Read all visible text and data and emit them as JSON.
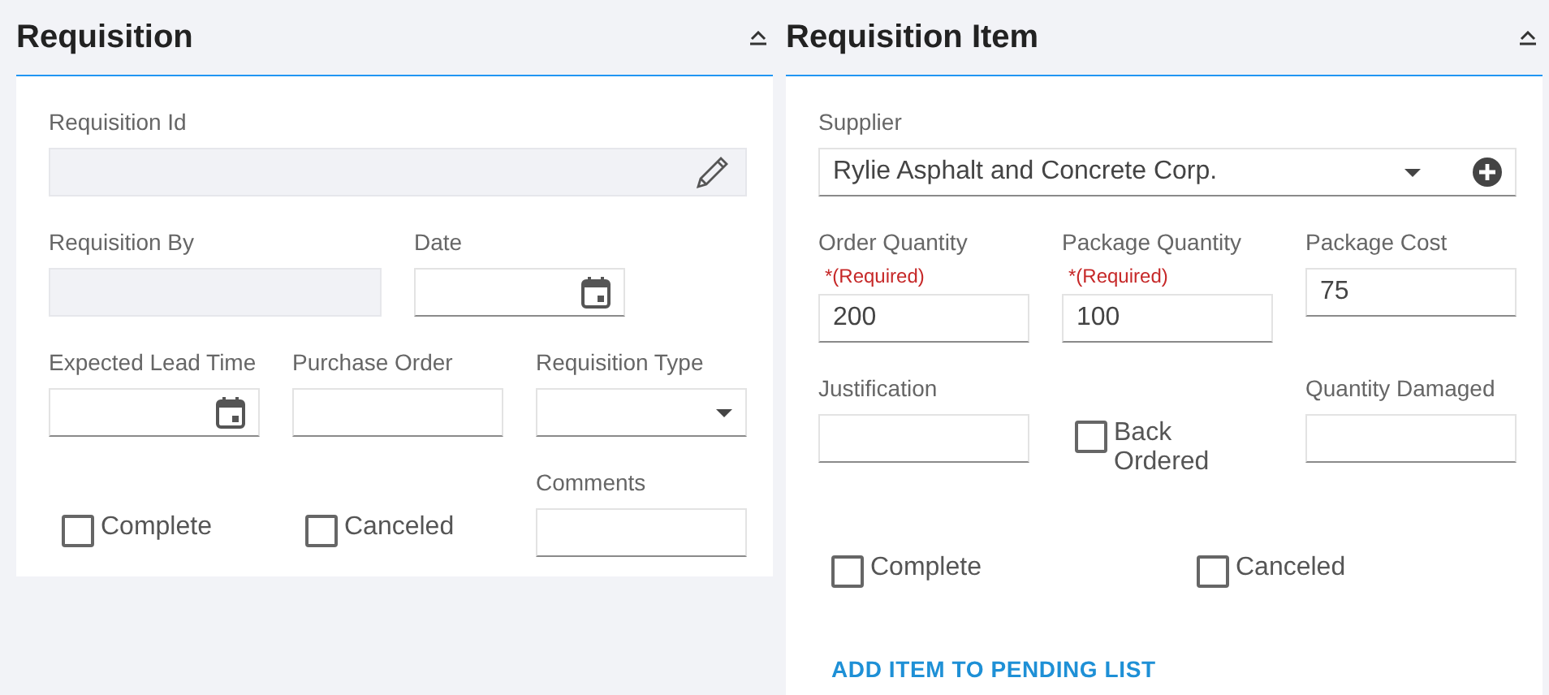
{
  "panels": [
    {
      "title": "Requisition",
      "rows": [
        [
          {
            "kind": "edit",
            "label": "Requisition Id",
            "disabled": true
          }
        ],
        [
          {
            "kind": "text",
            "label": "Requisition By",
            "disabled": true
          },
          {
            "kind": "date",
            "label": "Date"
          }
        ],
        [
          {
            "kind": "date",
            "label": "Expected Lead Time"
          },
          {
            "kind": "text",
            "label": "Purchase Order"
          },
          {
            "kind": "select",
            "label": "Requisition Type"
          }
        ],
        [
          {
            "kind": "checkbox",
            "label": "Complete",
            "checked": false
          },
          {
            "kind": "checkbox",
            "label": "Canceled",
            "checked": false
          },
          {
            "kind": "text",
            "label": "Comments"
          }
        ]
      ]
    },
    {
      "title": "Requisition Item",
      "rows": [
        [
          {
            "kind": "lookup",
            "label": "Supplier",
            "value": "Rylie Asphalt and Concrete Corp."
          }
        ],
        [
          {
            "kind": "text",
            "label": "Order Quantity",
            "required_note": "*(Required)",
            "value": "200"
          },
          {
            "kind": "text",
            "label": "Package Quantity",
            "required_note": "*(Required)",
            "value": "100"
          },
          {
            "kind": "text",
            "label": "Package Cost",
            "value": "75"
          }
        ],
        [
          {
            "kind": "text",
            "label": "Justification"
          },
          {
            "kind": "checkbox",
            "label": "Back Ordered",
            "checked": false
          },
          {
            "kind": "text",
            "label": "Quantity Damaged"
          }
        ],
        [
          {
            "kind": "checkbox",
            "label": "Complete",
            "checked": false
          },
          {
            "kind": "checkbox",
            "label": "Canceled",
            "checked": false
          }
        ]
      ],
      "action": "ADD ITEM TO PENDING LIST"
    }
  ]
}
